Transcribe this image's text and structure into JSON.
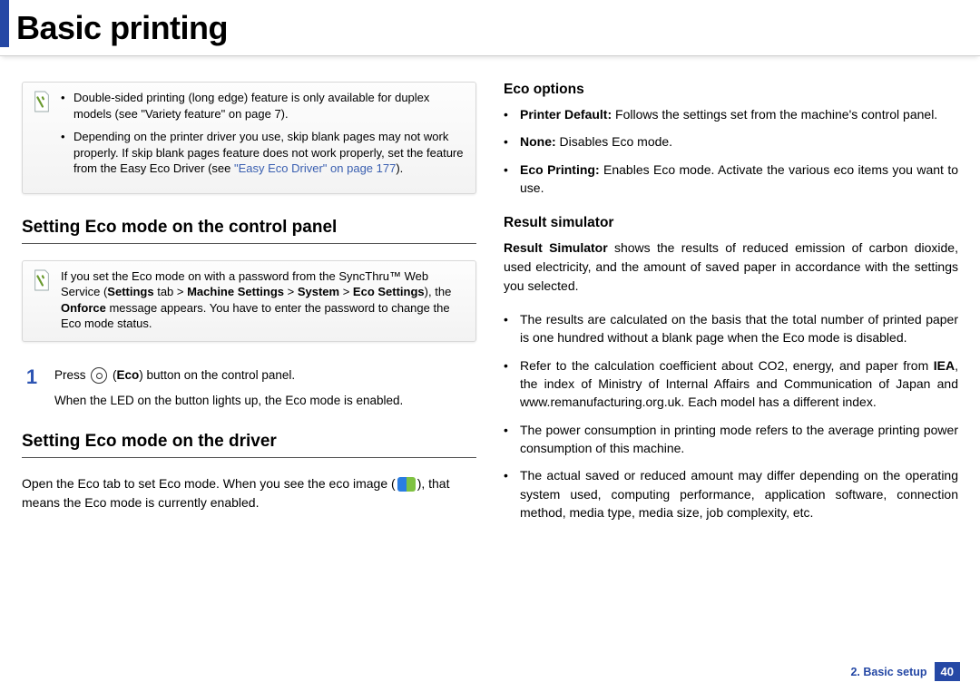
{
  "title": "Basic printing",
  "note_a": {
    "item1": "Double-sided printing (long edge) feature is only available for duplex models (see \"Variety feature\" on page 7).",
    "item2_a": "Depending on the printer driver you use, ",
    "item2_b": "skip blank pages may not work properly",
    "item2_c": ". If skip blank pages feature does not work properly, set the feature from the Easy Eco Driver (see ",
    "item2_link": "\"Easy Eco Driver\" on page 177",
    "item2_d": ")."
  },
  "sec1": {
    "heading": "Setting Eco mode on the control panel",
    "note_a": " If you set the Eco mode on with a password from the SyncThru™ Web Service (",
    "note_b": "Settings",
    "note_c": " tab > ",
    "note_d": "Machine Settings",
    "note_e": " > ",
    "note_f": "System",
    "note_g": " > ",
    "note_h": "Eco Settings",
    "note_i": "), the ",
    "note_j": "Onforce",
    "note_k": " message appears. You have to enter the password to change the Eco mode status.",
    "step_num": "1",
    "step_a": "Press ",
    "step_b": "Eco",
    "step_c": ") button on the control panel.",
    "step_line2": "When the LED on the button lights up, the Eco mode is enabled."
  },
  "sec2": {
    "heading": "Setting Eco mode on the driver",
    "body_a": "Open the Eco tab to set Eco mode. When you see the eco image (",
    "body_b": "), that means the Eco mode is currently enabled."
  },
  "sec3": {
    "heading": "Eco options",
    "items": [
      {
        "label": "Printer Default:",
        "text": " Follows the settings set from the machine's control panel."
      },
      {
        "label": "None:",
        "text": " Disables Eco mode."
      },
      {
        "label": "Eco Printing:",
        "text": " Enables Eco mode. Activate the various eco items you want to use."
      }
    ]
  },
  "sec4": {
    "heading": "Result simulator",
    "intro_label": "Result Simulator",
    "intro_text": " shows the results of reduced emission of carbon dioxide, used electricity, and the amount of saved paper in accordance with the settings you selected.",
    "bullets": {
      "b1": "The results are calculated on the basis that the total number of printed paper is one hundred without a blank page when the Eco mode is disabled.",
      "b2a": "Refer to the calculation coefficient about CO2, energy, and paper from ",
      "b2b": "IEA",
      "b2c": ", the index of Ministry of Internal Affairs and Communication of Japan and www.remanufacturing.org.uk. Each model has a different index.",
      "b3": "The power consumption in printing mode refers to the average printing power consumption of this machine.",
      "b4": "The actual saved or reduced amount may differ depending on the operating system used, computing performance, application software, connection method, media type, media size, job complexity, etc."
    }
  },
  "footer": {
    "chapter": "2. Basic setup",
    "page": "40"
  }
}
